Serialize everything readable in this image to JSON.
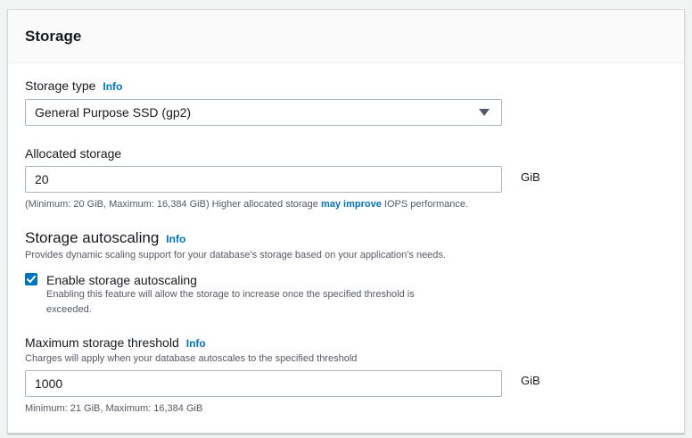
{
  "panel": {
    "title": "Storage"
  },
  "storage_type": {
    "label": "Storage type",
    "info": "Info",
    "value": "General Purpose SSD (gp2)"
  },
  "allocated_storage": {
    "label": "Allocated storage",
    "value": "20",
    "unit": "GiB",
    "hint_prefix": "(Minimum: 20 GiB, Maximum: 16,384 GiB) Higher allocated storage ",
    "hint_link": "may improve",
    "hint_suffix": " IOPS performance."
  },
  "autoscaling": {
    "title": "Storage autoscaling",
    "info": "Info",
    "description": "Provides dynamic scaling support for your database's storage based on your application's needs.",
    "checkbox_label": "Enable storage autoscaling",
    "checkbox_checked": true,
    "checkbox_desc_line1": "Enabling this feature will allow the storage to increase once the specified threshold is",
    "checkbox_desc_line2": "exceeded."
  },
  "max_threshold": {
    "label": "Maximum storage threshold",
    "info": "Info",
    "description": "Charges will apply when your database autoscales to the specified threshold",
    "value": "1000",
    "unit": "GiB",
    "hint": "Minimum: 21 GiB, Maximum: 16,384 GiB"
  },
  "colors": {
    "accent": "#0073bb",
    "text": "#16191f",
    "muted": "#545b64"
  }
}
